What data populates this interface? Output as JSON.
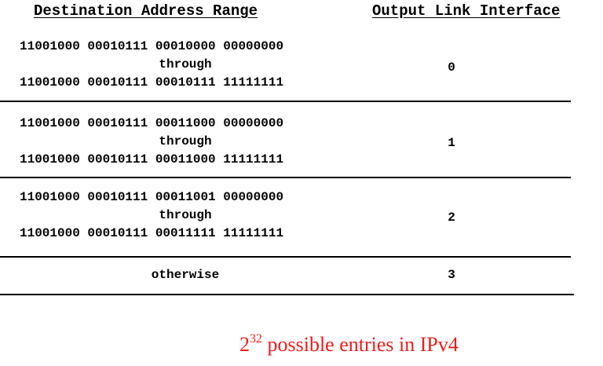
{
  "table": {
    "headers": {
      "destination": "Destination Address Range",
      "output": "Output Link Interface"
    },
    "rows": [
      {
        "from": "11001000 00010111 00010000 00000000",
        "through": "through",
        "to": "11001000 00010111 00010111 11111111",
        "interface": "0"
      },
      {
        "from": "11001000 00010111 00011000 00000000",
        "through": "through",
        "to": "11001000 00010111 00011000 11111111",
        "interface": "1"
      },
      {
        "from": "11001000 00010111 00011001 00000000",
        "through": "through",
        "to": "11001000 00010111 00011111 11111111",
        "interface": "2"
      }
    ],
    "otherwise": {
      "label": "otherwise",
      "interface": "3"
    }
  },
  "note": {
    "base": "2",
    "exponent": "32",
    "text": " possible entries in IPv4",
    "color": "#ee1c1c"
  }
}
